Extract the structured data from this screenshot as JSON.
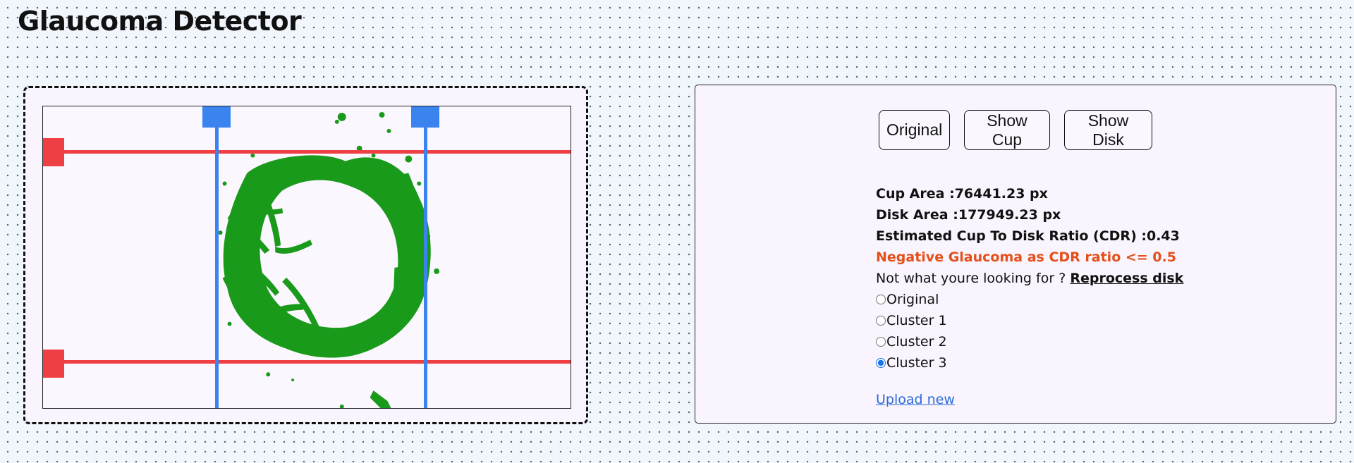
{
  "app": {
    "title": "Glaucoma Detector"
  },
  "colors": {
    "crop_horizontal_handles": "#ee4044",
    "crop_vertical_handles": "#3b84f0",
    "segmentation": "#1a9a1a",
    "verdict_text": "#e4501a",
    "link": "#2b6cd8"
  },
  "view_buttons": {
    "original_label": "Original",
    "cup_label": "Show Cup",
    "disk_label": "Show Disk"
  },
  "results": {
    "cup_area_label": "Cup Area :",
    "cup_area_value": "76441.23 px",
    "disk_area_label": "Disk Area :",
    "disk_area_value": "177949.23 px",
    "cdr_label": "Estimated Cup To Disk Ratio (CDR) :",
    "cdr_value": "0.43",
    "verdict": "Negative Glaucoma as CDR ratio <= 0.5",
    "reprocess_prompt": "Not what youre looking for ?",
    "reprocess_link": "Reprocess disk"
  },
  "cluster_options": [
    {
      "label": "Original",
      "checked": false
    },
    {
      "label": "Cluster 1",
      "checked": false
    },
    {
      "label": "Cluster 2",
      "checked": false
    },
    {
      "label": "Cluster 3",
      "checked": true
    }
  ],
  "upload_link": "Upload new"
}
